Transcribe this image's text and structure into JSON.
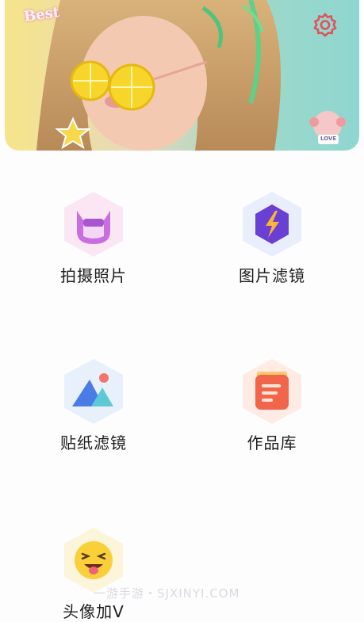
{
  "banner": {
    "badge_text": "Best",
    "sticker_text": "LOVE",
    "settings_icon": "gear-icon"
  },
  "menu": [
    {
      "label": "拍摄照片",
      "icon": "cat-face-icon"
    },
    {
      "label": "图片滤镜",
      "icon": "lightning-cube-icon"
    },
    {
      "label": "贴纸滤镜",
      "icon": "mountain-image-icon"
    },
    {
      "label": "作品库",
      "icon": "notes-folder-icon"
    },
    {
      "label": "头像加V",
      "icon": "laughing-emoji-icon"
    }
  ],
  "watermark": "一游手游・SJXINYI.COM",
  "colors": {
    "settings": "#e0525a",
    "hex_pink": "#fbe7f3",
    "hex_blue": "#e8eefb",
    "hex_peach": "#fdebe4",
    "hex_yellow": "#fdf5d9"
  }
}
